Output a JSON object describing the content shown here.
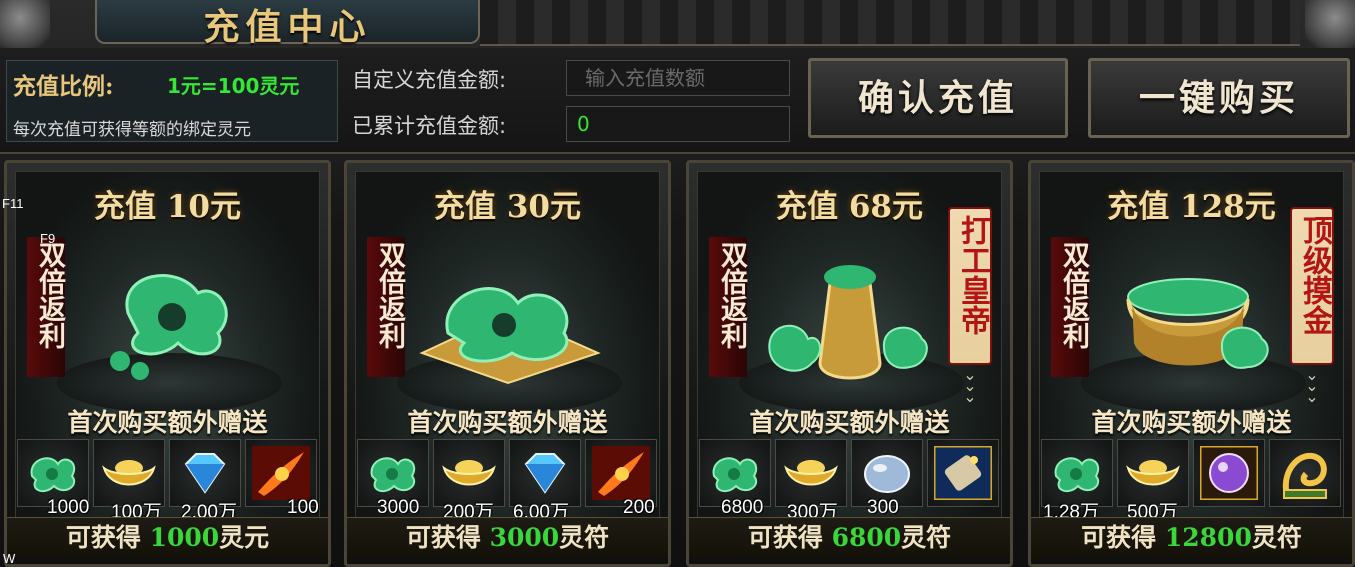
{
  "window": {
    "title": "充值中心"
  },
  "header": {
    "ratio_label": "充值比例:",
    "ratio_value": "1元=100灵元",
    "ratio_note": "每次充值可获得等额的绑定灵元",
    "custom_label": "自定义充值金额:",
    "custom_placeholder": "输入充值数额",
    "total_label": "已累计充值金额:",
    "total_value": "0",
    "confirm_button": "确认充值",
    "buy_all_button": "一键购买"
  },
  "hints": {
    "f11": "F11",
    "f9": "F9",
    "w": "W"
  },
  "cards": [
    {
      "title": "充值 10元",
      "left_ribbon": "双倍返利",
      "right_ribbon": "",
      "bonus_label": "首次购买额外赠送",
      "items": [
        {
          "icon": "jade-icon",
          "qty": "1000"
        },
        {
          "icon": "gold-ingot-icon",
          "qty": "100万"
        },
        {
          "icon": "diamond-icon",
          "qty": "2.00万"
        },
        {
          "icon": "fire-scroll-icon",
          "qty": "100"
        }
      ],
      "gain_prefix": "可获得",
      "gain_amount": "1000",
      "gain_unit": "灵元"
    },
    {
      "title": "充值 30元",
      "left_ribbon": "双倍返利",
      "right_ribbon": "",
      "bonus_label": "首次购买额外赠送",
      "items": [
        {
          "icon": "jade-icon",
          "qty": "3000"
        },
        {
          "icon": "gold-ingot-icon",
          "qty": "200万"
        },
        {
          "icon": "diamond-icon",
          "qty": "6.00万"
        },
        {
          "icon": "fire-scroll-icon",
          "qty": "200"
        }
      ],
      "gain_prefix": "可获得",
      "gain_amount": "3000",
      "gain_unit": "灵符"
    },
    {
      "title": "充值 68元",
      "left_ribbon": "双倍返利",
      "right_ribbon": "打工皇帝",
      "bonus_label": "首次购买额外赠送",
      "items": [
        {
          "icon": "jade-icon",
          "qty": "6800"
        },
        {
          "icon": "gold-ingot-icon",
          "qty": "300万"
        },
        {
          "icon": "pearl-icon",
          "qty": "300"
        },
        {
          "icon": "blue-scroll-icon",
          "qty": ""
        }
      ],
      "gain_prefix": "可获得",
      "gain_amount": "6800",
      "gain_unit": "灵符"
    },
    {
      "title": "充值 128元",
      "left_ribbon": "双倍返利",
      "right_ribbon": "顶级摸金",
      "bonus_label": "首次购买额外赠送",
      "items": [
        {
          "icon": "jade-icon",
          "qty": "1.28万"
        },
        {
          "icon": "gold-ingot-icon",
          "qty": "500万"
        },
        {
          "icon": "purple-orb-icon",
          "qty": ""
        },
        {
          "icon": "golden-dragon-icon",
          "qty": ""
        }
      ],
      "gain_prefix": "可获得",
      "gain_amount": "12800",
      "gain_unit": "灵符"
    }
  ],
  "colors": {
    "gold_text": "#e8c77a",
    "green_value": "#34e834",
    "ribbon_red": "#b41414"
  }
}
